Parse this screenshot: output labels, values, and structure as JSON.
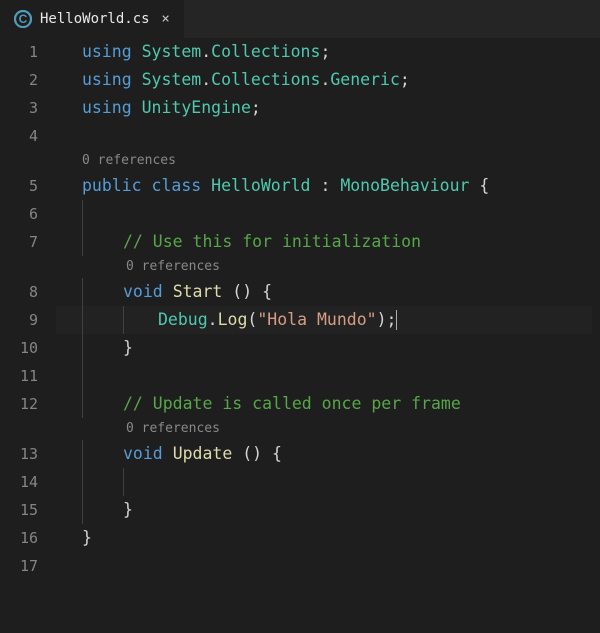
{
  "tab": {
    "filename": "HelloWorld.cs",
    "close_icon": "×"
  },
  "codelens": {
    "references_class": "0 references",
    "references_start": "0 references",
    "references_update": "0 references"
  },
  "code": {
    "l1": {
      "kw1": "using",
      "type1": "System",
      "punc1": ".",
      "type2": "Collections",
      "punc2": ";"
    },
    "l2": {
      "kw1": "using",
      "type1": "System",
      "punc1": ".",
      "type2": "Collections",
      "punc2": ".",
      "type3": "Generic",
      "punc3": ";"
    },
    "l3": {
      "kw1": "using",
      "type1": "UnityEngine",
      "punc1": ";"
    },
    "l5": {
      "kw1": "public",
      "kw2": "class",
      "type1": "HelloWorld",
      "punc1": ":",
      "type2": "MonoBehaviour",
      "punc2": "{"
    },
    "l7": {
      "comment": "// Use this for initialization"
    },
    "l8": {
      "kw1": "void",
      "fn1": "Start",
      "punc1": "() {"
    },
    "l9": {
      "type1": "Debug",
      "punc1": ".",
      "fn1": "Log",
      "punc2": "(",
      "str1": "\"Hola Mundo\"",
      "punc3": ");"
    },
    "l10": {
      "punc1": "}"
    },
    "l12": {
      "comment": "// Update is called once per frame"
    },
    "l13": {
      "kw1": "void",
      "fn1": "Update",
      "punc1": "() {"
    },
    "l15": {
      "punc1": "}"
    },
    "l16": {
      "punc1": "}"
    }
  },
  "line_numbers": {
    "n1": "1",
    "n2": "2",
    "n3": "3",
    "n4": "4",
    "n5": "5",
    "n6": "6",
    "n7": "7",
    "n8": "8",
    "n9": "9",
    "n10": "10",
    "n11": "11",
    "n12": "12",
    "n13": "13",
    "n14": "14",
    "n15": "15",
    "n16": "16",
    "n17": "17"
  }
}
